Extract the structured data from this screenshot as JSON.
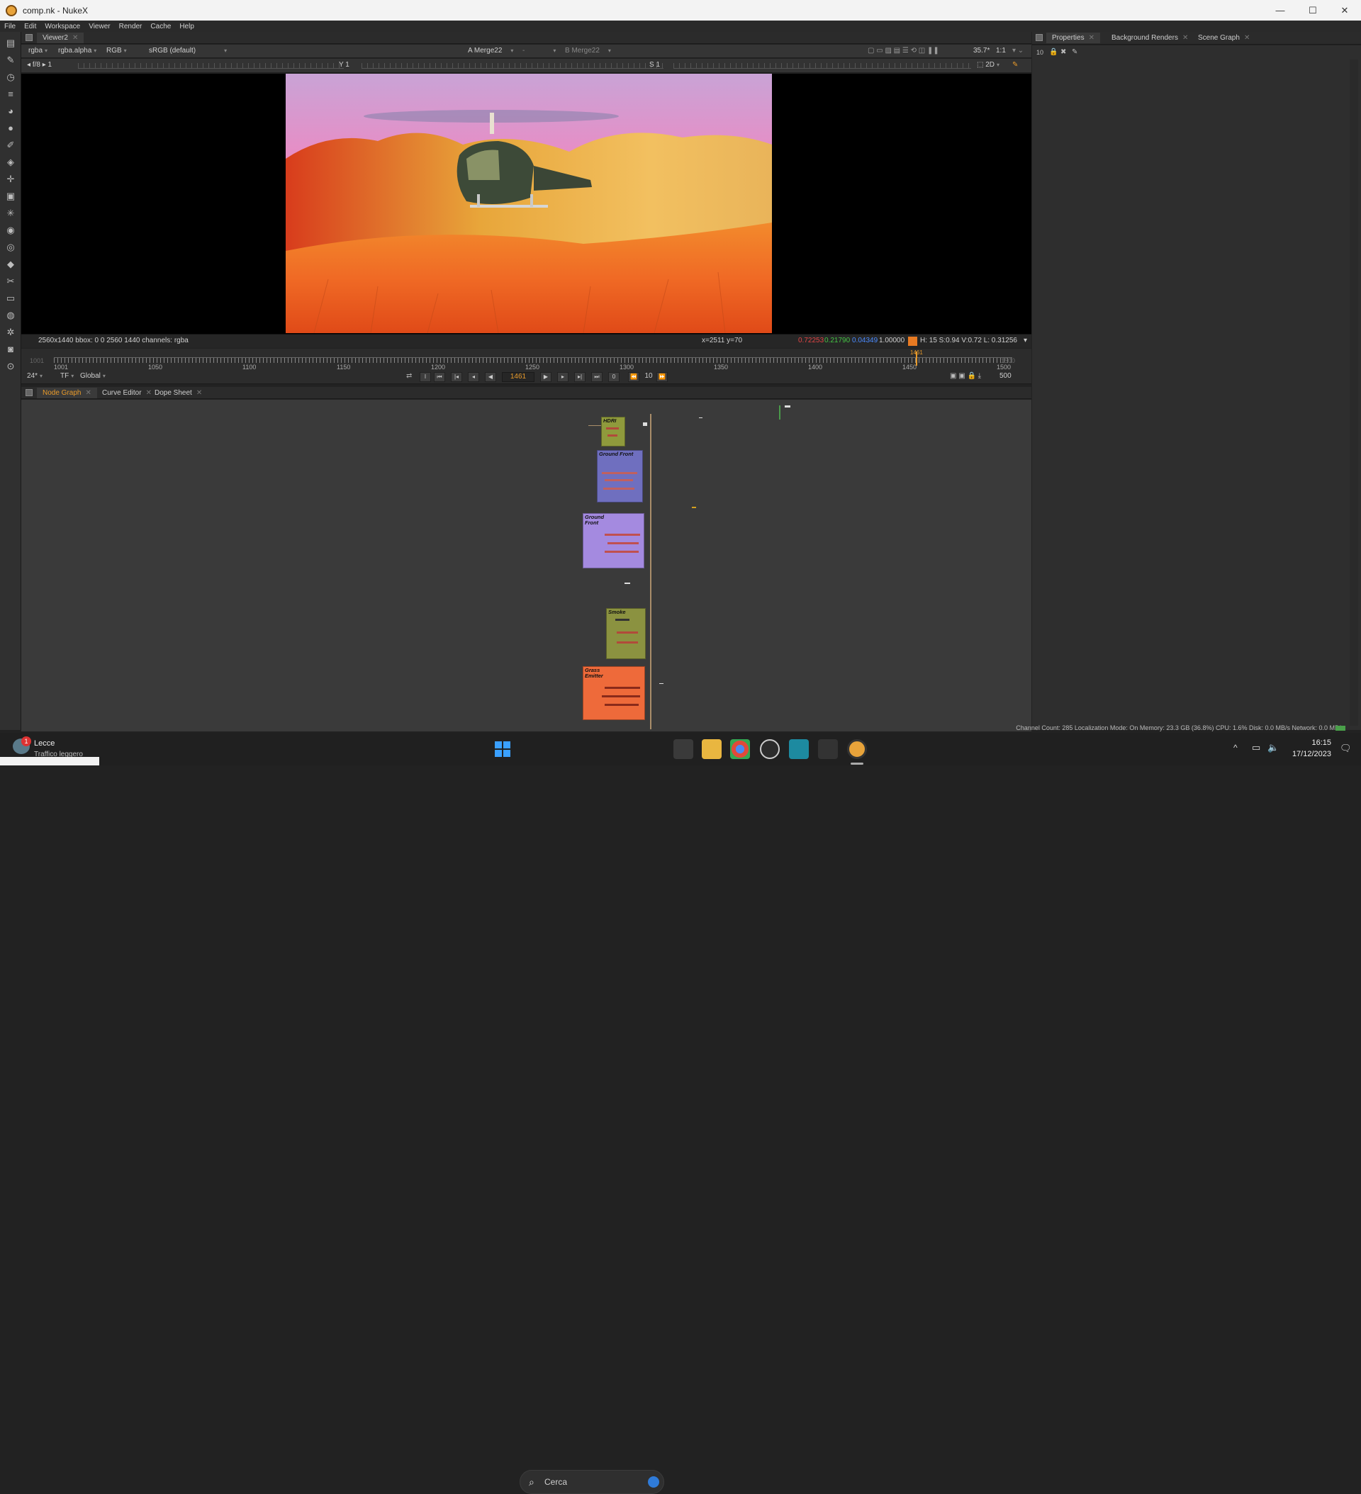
{
  "window": {
    "title": "comp.nk - NukeX",
    "minimize_icon": "—",
    "maximize_icon": "☐",
    "close_icon": "✕"
  },
  "menu": [
    "File",
    "Edit",
    "Workspace",
    "Viewer",
    "Render",
    "Cache",
    "Help"
  ],
  "viewer": {
    "tab_label": "Viewer2",
    "channels": "rgba",
    "channel_alpha": "rgba.alpha",
    "display": "RGB",
    "colorspace": "sRGB (default)",
    "input_a_label": "A",
    "input_a": "Merge22",
    "input_mid": "-",
    "input_b_label": "B",
    "input_b": "Merge22",
    "zoom": "35.7*",
    "ratio": "1:1",
    "fstop": "f/8",
    "frame_increment": "1",
    "y_label": "Y",
    "y_value": "1",
    "s_label": "S",
    "s_value": "1",
    "view_mode": "2D",
    "info_left": "2560x1440  bbox: 0 0 2560 1440 channels: rgba",
    "info_coords": "x=2511 y=70",
    "pixel_r": "0.72253",
    "pixel_g": "0.21790",
    "pixel_b": "0.04349",
    "pixel_a": "1.00000",
    "pixel_swatch_color": "#e87a22",
    "pixel_hsv": "H: 15 S:0.94 V:0.72  L: 0.31256"
  },
  "timeline": {
    "start_label": "1001",
    "end_label": "1500",
    "ticks": [
      "1001",
      "1050",
      "1100",
      "1150",
      "1200",
      "1250",
      "1300",
      "1350",
      "1400",
      "1450",
      "1500"
    ],
    "current_frame": "1461",
    "fps": "24*",
    "tf": "TF",
    "scope": "Global",
    "step": "10",
    "end_frame_field": "500",
    "loop_count": "0"
  },
  "node_graph": {
    "tabs": [
      {
        "label": "Node Graph",
        "active": true
      },
      {
        "label": "Curve Editor",
        "active": false
      },
      {
        "label": "Dope Sheet",
        "active": false
      }
    ],
    "backdrops": [
      {
        "label": "HDRI",
        "color": "#8f9a3c"
      },
      {
        "label": "Ground Front",
        "color": "#6f6fbf"
      },
      {
        "label": "Ground Front",
        "color": "#a48ae0"
      },
      {
        "label": "Smoke",
        "color": "#8b9240"
      },
      {
        "label": "Grass Emitter",
        "color": "#ee6a3a"
      }
    ]
  },
  "properties": {
    "tabs": [
      "Properties",
      "Background Renders",
      "Scene Graph"
    ],
    "max_panels": "10"
  },
  "status": "Channel Count: 285  Localization Mode: On  Memory: 23.3 GB (36.8%)  CPU: 1.6%  Disk: 0.0 MB/s  Network: 0.0 MB/s",
  "taskbar": {
    "weather_city": "Lecce",
    "weather_sub": "Traffico leggero",
    "weather_badge": "1",
    "search_placeholder": "Cerca",
    "time": "16:15",
    "date": "17/12/2023"
  }
}
